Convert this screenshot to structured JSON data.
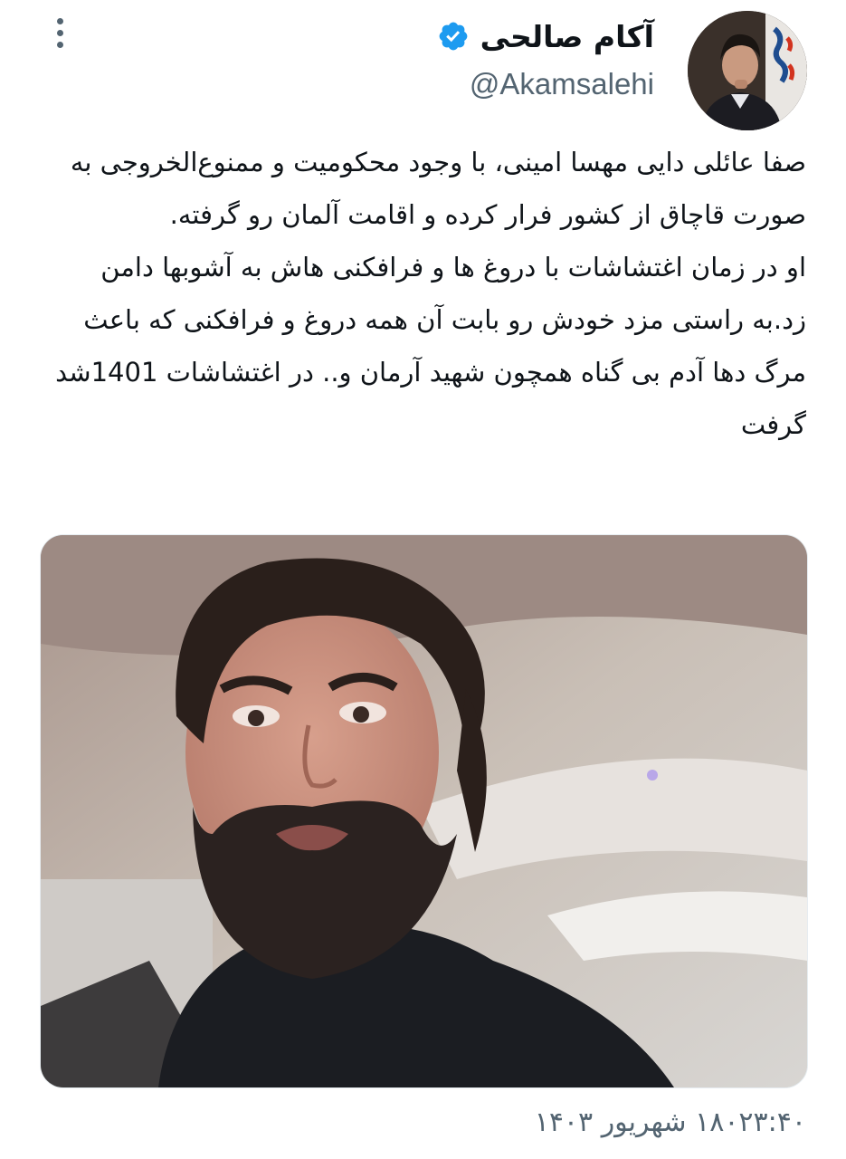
{
  "author": {
    "display_name": "آکام صالحی",
    "handle": "@Akamsalehi",
    "verified": true,
    "verified_color": "#1d9bf0"
  },
  "icons": {
    "more": "more-vertical-icon",
    "verified": "verified-badge-icon"
  },
  "tweet": {
    "paragraph1": "صفا عائلی دایی مهسا امینی، با وجود محکومیت و ممنوع‌الخروجی به صورت قاچاق از کشور فرار کرده و اقامت آلمان رو گرفته.",
    "paragraph2": "او در زمان اغتشاشات با دروغ ها و فرافکنی هاش به آشوبها دامن زد.به راستی مزد خودش رو بابت آن همه دروغ و فرافکنی که باعث مرگ دها آدم بی گناه همچون شهید آرمان و.. در اغتشاشات 1401شد گرفت"
  },
  "timestamp": "۱۸۰۲۳:۴۰ شهریور ۱۴۰۳",
  "colors": {
    "text_primary": "#0f1419",
    "text_secondary": "#536471",
    "background": "#ffffff"
  }
}
